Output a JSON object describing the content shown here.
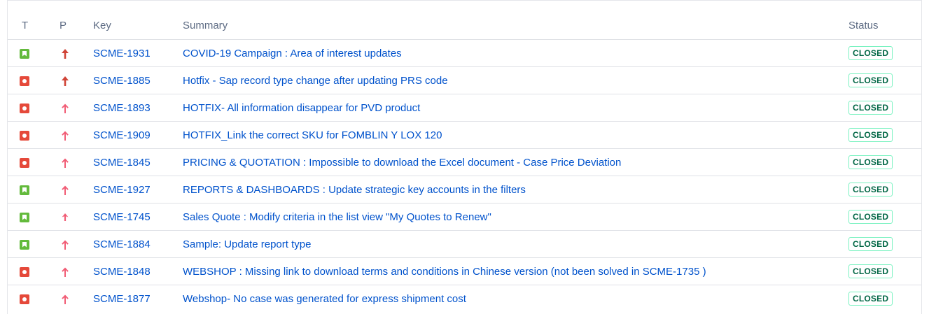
{
  "table": {
    "headers": {
      "type": "T",
      "priority": "P",
      "key": "Key",
      "summary": "Summary",
      "status": "Status"
    },
    "rows": [
      {
        "type": "story",
        "priority": "highest",
        "key": "SCME-1931",
        "summary": "COVID-19 Campaign : Area of interest updates",
        "status": "CLOSED"
      },
      {
        "type": "bug",
        "priority": "highest",
        "key": "SCME-1885",
        "summary": "Hotfix - Sap record type change after updating PRS code",
        "status": "CLOSED"
      },
      {
        "type": "bug",
        "priority": "high",
        "key": "SCME-1893",
        "summary": "HOTFIX- All information disappear for PVD product",
        "status": "CLOSED"
      },
      {
        "type": "bug",
        "priority": "high",
        "key": "SCME-1909",
        "summary": "HOTFIX_Link the correct SKU for FOMBLIN Y LOX 120",
        "status": "CLOSED"
      },
      {
        "type": "bug",
        "priority": "high",
        "key": "SCME-1845",
        "summary": "PRICING & QUOTATION : Impossible to download the Excel document - Case Price Deviation",
        "status": "CLOSED"
      },
      {
        "type": "story",
        "priority": "high",
        "key": "SCME-1927",
        "summary": "REPORTS & DASHBOARDS : Update strategic key accounts in the filters",
        "status": "CLOSED"
      },
      {
        "type": "story",
        "priority": "medium",
        "key": "SCME-1745",
        "summary": "Sales Quote : Modify criteria in the list view \"My Quotes to Renew\"",
        "status": "CLOSED"
      },
      {
        "type": "story",
        "priority": "high",
        "key": "SCME-1884",
        "summary": "Sample: Update report type",
        "status": "CLOSED"
      },
      {
        "type": "bug",
        "priority": "high",
        "key": "SCME-1848",
        "summary": "WEBSHOP : Missing link to download terms and conditions in Chinese version (not been solved in SCME-1735 )",
        "status": "CLOSED"
      },
      {
        "type": "bug",
        "priority": "high",
        "key": "SCME-1877",
        "summary": "Webshop- No case was generated for express shipment cost",
        "status": "CLOSED"
      }
    ]
  },
  "colors": {
    "story": "#63ba3c",
    "bug": "#e5493a",
    "priority_highest": "#d04437",
    "priority_high": "#f15c75",
    "link": "#0052cc",
    "status_closed_border": "#79f2c0",
    "status_closed_text": "#006644"
  }
}
